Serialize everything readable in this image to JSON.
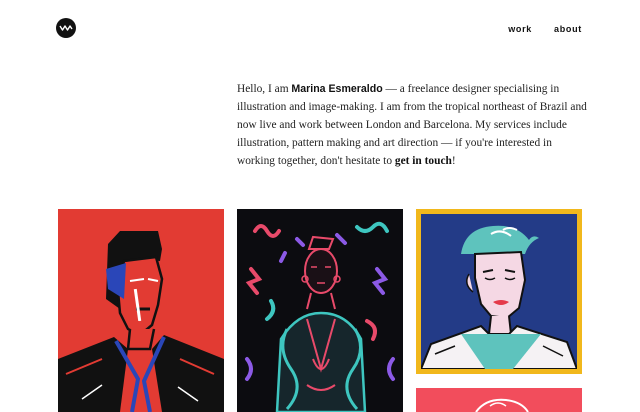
{
  "brand": {
    "logo_icon": "wave-logo-icon",
    "logo_bg": "#111111"
  },
  "nav": {
    "items": [
      {
        "label": "work"
      },
      {
        "label": "about"
      }
    ]
  },
  "intro": {
    "greeting": "Hello, I am ",
    "name": "Marina Esmeraldo",
    "body": " — a freelance designer specialising in illustration and image-making. I am from the tropical northeast of Brazil and now live and work between London and Barcelona. My services include illustration, pattern making and art direction — if you're interested in working together, don't hesitate to ",
    "cta": "get in touch",
    "end": "!"
  },
  "portfolio": {
    "tiles": [
      {
        "subject": "portrait-red",
        "background": "#e23b33"
      },
      {
        "subject": "portrait-neon",
        "background": "#0c0c10"
      },
      {
        "subject": "portrait-blue",
        "frame": "#f1b81c",
        "background": "#233b87"
      },
      {
        "subject": "portrait-pink",
        "background": "#f24d5c"
      }
    ]
  }
}
